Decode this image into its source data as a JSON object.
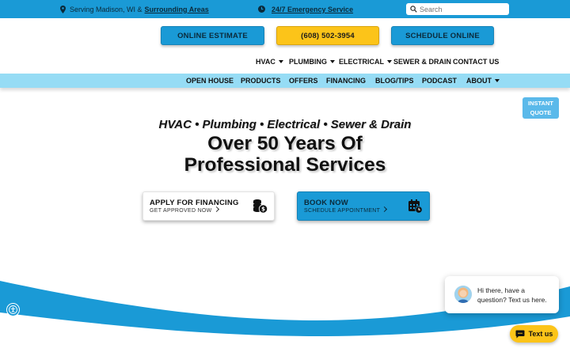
{
  "topbar": {
    "serving_prefix": "Serving Madison, WI &",
    "serving_link": "Surrounding Areas",
    "emergency_link": "24/7 Emergency Service",
    "search_placeholder": "Search"
  },
  "cta": {
    "estimate": "ONLINE ESTIMATE",
    "phone": "(608) 502-3954",
    "schedule": "SCHEDULE ONLINE"
  },
  "nav_primary": [
    "HVAC",
    "PLUMBING",
    "ELECTRICAL",
    "SEWER & DRAIN",
    "CONTACT US"
  ],
  "nav_secondary": [
    "OPEN HOUSE",
    "PRODUCTS",
    "OFFERS",
    "FINANCING",
    "BLOG/TIPS",
    "PODCAST",
    "ABOUT"
  ],
  "instant_quote": {
    "line1": "INSTANT",
    "line2": "QUOTE"
  },
  "hero": {
    "subtitle": "HVAC • Plumbing • Electrical • Sewer & Drain",
    "title_line1": "Over 50 Years Of",
    "title_line2": "Professional Services"
  },
  "cards": {
    "financing": {
      "title": "APPLY FOR FINANCING",
      "subtitle": "GET APPROVED NOW"
    },
    "book": {
      "title": "BOOK NOW",
      "subtitle": "SCHEDULE APPOINTMENT"
    }
  },
  "chat": {
    "message": "Hi there, have a question? Text us here.",
    "button": "Text us"
  },
  "colors": {
    "brand_blue": "#1a9ad6",
    "light_blue": "#96dcf5",
    "yellow": "#fcc419"
  }
}
